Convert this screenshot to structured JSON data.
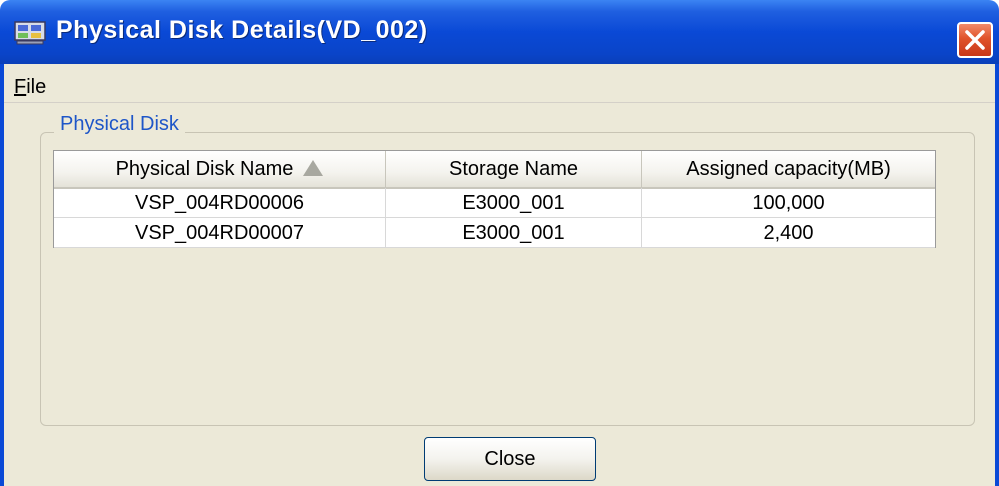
{
  "window": {
    "title": "Physical Disk Details(VD_002)"
  },
  "menu": {
    "file_mnemonic": "F",
    "file_rest": "ile"
  },
  "group": {
    "label": "Physical Disk"
  },
  "table": {
    "columns": [
      "Physical Disk Name",
      "Storage Name",
      "Assigned capacity(MB)"
    ],
    "sort_column": "Physical Disk Name",
    "sort_direction": "ascending",
    "rows": [
      [
        "VSP_004RD00006",
        "E3000_001",
        "100,000"
      ],
      [
        "VSP_004RD00007",
        "E3000_001",
        "2,400"
      ]
    ]
  },
  "buttons": {
    "close_label": "Close"
  },
  "colors": {
    "titlebar": "#0a49d6",
    "face": "#ece9d8",
    "group_label": "#1e56c8",
    "close_button": "#e0532a"
  }
}
